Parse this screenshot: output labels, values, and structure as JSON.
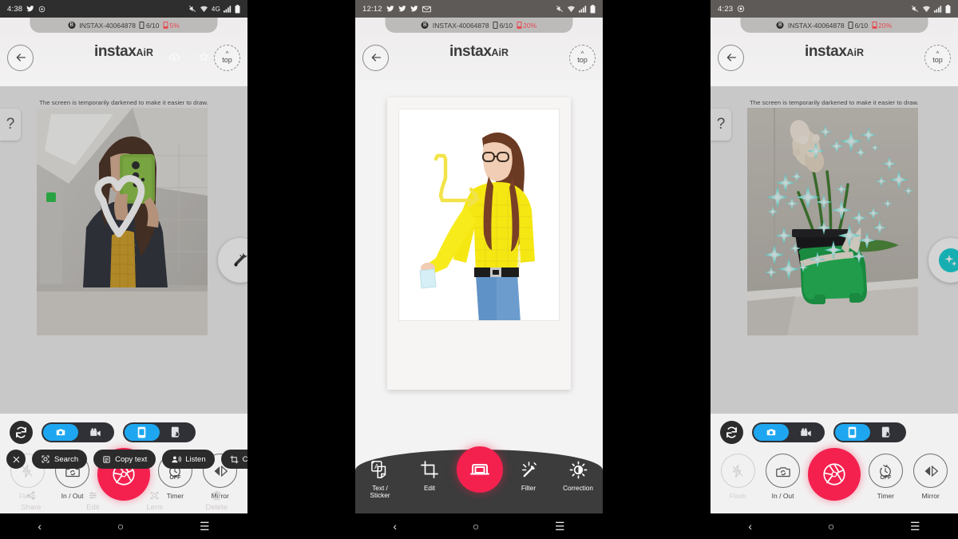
{
  "brand": {
    "name": "instax",
    "suffix": "AiR"
  },
  "device_bar": {
    "bluetooth_icon": "bluetooth-icon",
    "device_name": "INSTAX-40064878",
    "film_count": "6/10",
    "battery": "20%",
    "battery_p1": "5%",
    "battery_color": "#e8494f"
  },
  "panels": [
    {
      "id": "draw-panel",
      "status": {
        "clock": "4:38",
        "icons": [
          "twitter-icon",
          "settings-icon"
        ],
        "right_icons": [
          "mute-icon",
          "wifi-icon",
          "4g-icon",
          "signal-icon",
          "battery-icon"
        ],
        "network": "4G",
        "bar_color": "#2e2e2e"
      },
      "device_bar": {
        "device_name": "INSTAX-40064878",
        "film_count": "6/10",
        "battery": "5%"
      },
      "header": {
        "back": "back-arrow",
        "top": "top",
        "chrome_icons": [
          "cloud-download-icon",
          "star-icon"
        ]
      },
      "hint": "The screen is temporarily darkened to make it easier to draw.",
      "help_label": "?",
      "side_tool": "pen-icon",
      "photo": {
        "type": "plain",
        "caption": "mirror selfie with white heart drawing",
        "drawing_color": "#ffffff"
      },
      "toggles": [
        {
          "left": "photo-camera-icon",
          "right": "video-camera-icon",
          "active": "left"
        },
        {
          "left": "phone-portrait-icon",
          "right": "tap-hand-icon",
          "active": "left"
        }
      ],
      "refresh": "refresh-icon",
      "controls": [
        {
          "label": "Flash",
          "icon": "flash-off-icon",
          "disabled": true
        },
        {
          "label": "In / Out",
          "icon": "camera-flip-icon",
          "disabled": false
        },
        {
          "label": "",
          "icon": "shutter-icon",
          "shutter": true
        },
        {
          "label": "Timer",
          "icon": "timer-icon",
          "badge": "OFF",
          "disabled": false
        },
        {
          "label": "Mirror",
          "icon": "mirror-icon",
          "disabled": false
        }
      ],
      "lens_overlay": {
        "close": "close-icon",
        "pills": [
          {
            "label": "Search",
            "icon": "lens-search-icon"
          },
          {
            "label": "Copy text",
            "icon": "copy-text-icon"
          },
          {
            "label": "Listen",
            "icon": "listen-icon"
          },
          {
            "label": "C",
            "icon": "crop-icon"
          }
        ],
        "photos_actions": [
          {
            "label": "Share",
            "icon": "share-icon"
          },
          {
            "label": "Edit",
            "icon": "edit-sliders-icon"
          },
          {
            "label": "Lens",
            "icon": "lens-icon"
          },
          {
            "label": "Delete",
            "icon": "trash-icon"
          }
        ]
      }
    },
    {
      "id": "print-preview-panel",
      "status": {
        "clock": "12:12",
        "icons": [
          "twitter-icon",
          "twitter-icon",
          "twitter-icon",
          "mail-icon"
        ],
        "right_icons": [
          "mute-icon",
          "wifi-icon",
          "signal-icon",
          "battery-icon"
        ],
        "bar_color": "#5e5a58"
      },
      "device_bar": {
        "device_name": "INSTAX-40064878",
        "film_count": "6/10",
        "battery": "20%"
      },
      "header": {
        "back": "back-arrow",
        "top": "top"
      },
      "photo": {
        "type": "polaroid",
        "caption": "woman in yellow sweater with yellow drawn arrow",
        "drawing_color": "#f5e642"
      },
      "edit_tools": [
        {
          "label": "Text /\nSticker",
          "icon": "text-sticker-icon"
        },
        {
          "label": "Edit",
          "icon": "crop-icon"
        },
        {
          "label": "",
          "icon": "printer-icon",
          "primary": true
        },
        {
          "label": "Filter",
          "icon": "magic-wand-icon"
        },
        {
          "label": "Correction",
          "icon": "brightness-icon"
        }
      ]
    },
    {
      "id": "sticker-panel",
      "status": {
        "clock": "4:23",
        "icons": [
          "record-icon"
        ],
        "right_icons": [
          "mute-icon",
          "wifi-icon",
          "signal-icon",
          "battery-icon"
        ],
        "bar_color": "#5e5a58"
      },
      "device_bar": {
        "device_name": "INSTAX-40064878",
        "film_count": "6/10",
        "battery": "20%"
      },
      "header": {
        "back": "back-arrow",
        "top": "top"
      },
      "hint": "The screen is temporarily darkened to make it easier to draw.",
      "help_label": "?",
      "side_tool": "sparkle-icon",
      "side_tool_color": "#16cfd4",
      "photo": {
        "type": "plain",
        "caption": "green bulldog planter with cyan sparkle stamps",
        "drawing_color": "#5ff0e6"
      },
      "toggles": [
        {
          "left": "photo-camera-icon",
          "right": "video-camera-icon",
          "active": "left"
        },
        {
          "left": "phone-portrait-icon",
          "right": "tap-hand-icon",
          "active": "left"
        }
      ],
      "refresh": "refresh-icon",
      "controls": [
        {
          "label": "Flash",
          "icon": "flash-off-icon",
          "disabled": true
        },
        {
          "label": "In / Out",
          "icon": "camera-flip-icon",
          "disabled": false
        },
        {
          "label": "",
          "icon": "shutter-icon",
          "shutter": true
        },
        {
          "label": "Timer",
          "icon": "timer-icon",
          "badge": "OFF",
          "disabled": false
        },
        {
          "label": "Mirror",
          "icon": "mirror-icon",
          "disabled": false
        }
      ]
    }
  ],
  "navbar": {
    "back": "nav-back-icon",
    "home": "nav-home-icon",
    "recents": "nav-recents-icon"
  },
  "colors": {
    "accent_pink": "#f4214f",
    "toggle_blue": "#1ea7f0",
    "cyan": "#16cfd4",
    "battery_red": "#e8494f"
  }
}
